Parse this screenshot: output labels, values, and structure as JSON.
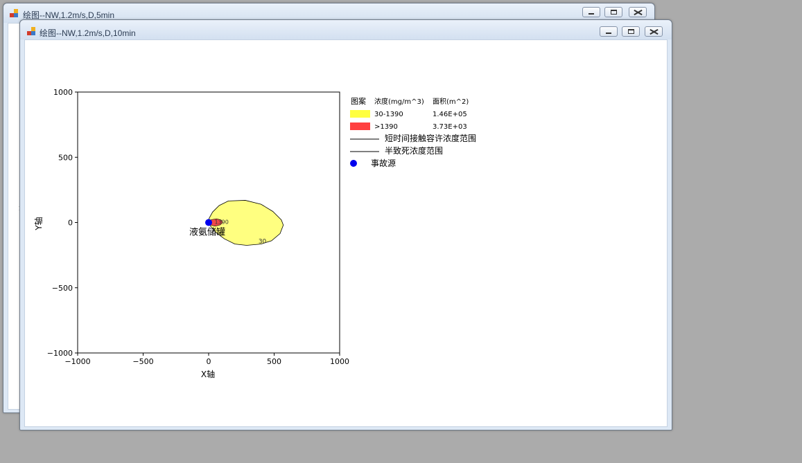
{
  "back_window": {
    "title": "绘图--NW,1.2m/s,D,5min",
    "partial_label": "Y轴"
  },
  "front_window": {
    "title": "绘图--NW,1.2m/s,D,10min"
  },
  "controls": {
    "minimize": "minimize",
    "maximize": "maximize",
    "close": "close"
  },
  "chart_data": {
    "type": "contour",
    "xlabel": "X轴",
    "ylabel": "Y轴",
    "xlim": [
      -1000,
      1000
    ],
    "ylim": [
      -1000,
      1000
    ],
    "xticks": [
      -1000,
      -500,
      0,
      500,
      1000
    ],
    "yticks": [
      -1000,
      -500,
      0,
      500,
      1000
    ],
    "x_tick_labels": [
      "−1000",
      "−500",
      "0",
      "500",
      "1000"
    ],
    "y_tick_labels": [
      "−1000",
      "−500",
      "0",
      "500",
      "1000"
    ],
    "outer_contour": {
      "label": "30",
      "color": "#ffff80",
      "points": [
        [
          -5,
          0
        ],
        [
          5,
          35
        ],
        [
          30,
          80
        ],
        [
          80,
          130
        ],
        [
          150,
          165
        ],
        [
          280,
          170
        ],
        [
          400,
          140
        ],
        [
          490,
          85
        ],
        [
          555,
          20
        ],
        [
          570,
          -20
        ],
        [
          545,
          -85
        ],
        [
          480,
          -140
        ],
        [
          400,
          -165
        ],
        [
          290,
          -175
        ],
        [
          200,
          -165
        ],
        [
          120,
          -125
        ],
        [
          60,
          -80
        ],
        [
          20,
          -35
        ],
        [
          -5,
          0
        ]
      ]
    },
    "inner_contour": {
      "label": "1390",
      "color": "#f04848",
      "points": [
        [
          0,
          0
        ],
        [
          20,
          22
        ],
        [
          60,
          28
        ],
        [
          95,
          20
        ],
        [
          105,
          0
        ],
        [
          90,
          -18
        ],
        [
          50,
          -28
        ],
        [
          15,
          -20
        ],
        [
          0,
          0
        ]
      ]
    },
    "source": {
      "x": 0,
      "y": 0,
      "label": "液氨储罐",
      "color": "#0000ee"
    },
    "legend": {
      "header": [
        "图案",
        "浓度(mg/m^3)",
        "面积(m^2)"
      ],
      "rows": [
        {
          "swatch": "#ffff40",
          "range": "30-1390",
          "area": "1.46E+05"
        },
        {
          "swatch": "#ff4040",
          "range": ">1390",
          "area": "3.73E+03"
        }
      ],
      "lines": [
        "短时间接触容许浓度范围",
        "半致死浓度范围"
      ],
      "marker": "事故源"
    }
  }
}
